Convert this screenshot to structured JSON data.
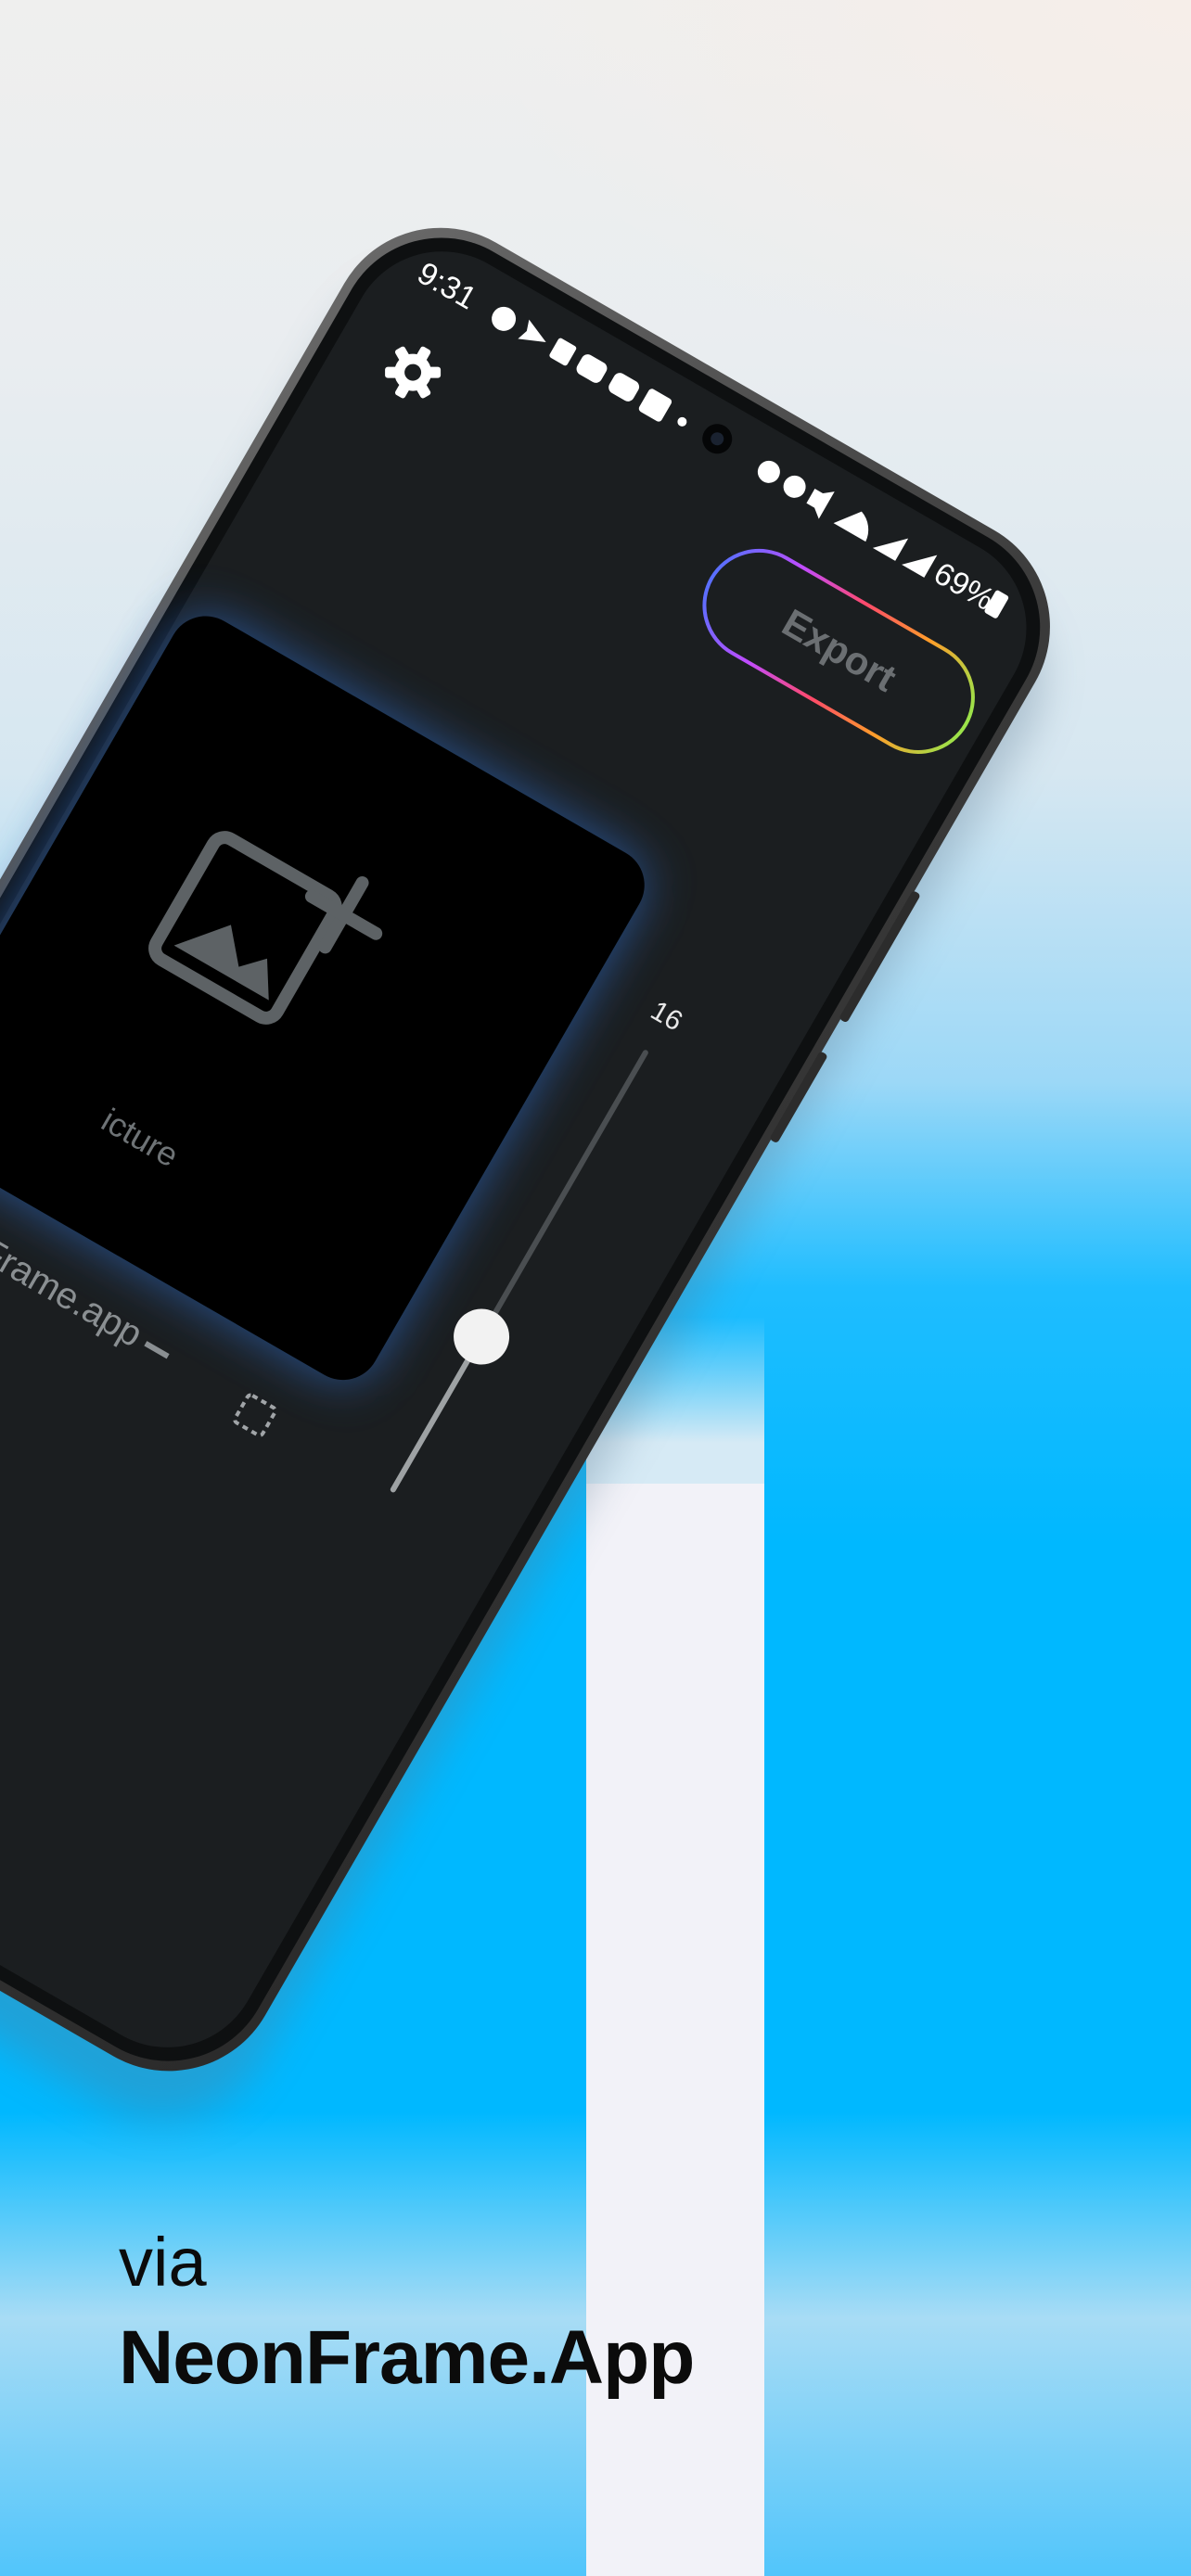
{
  "status_bar": {
    "time": "9:31",
    "battery": "69%",
    "left_icons": [
      "chat-bubble-icon",
      "send-icon",
      "news-icon",
      "youtube-icon",
      "youtube-icon",
      "linkedin-icon",
      "dot-icon"
    ],
    "right_icons": [
      "alarm-icon",
      "alarm-icon",
      "mute-icon",
      "wifi-icon",
      "signal-icon",
      "signal-icon",
      "battery-icon"
    ]
  },
  "app": {
    "export_label": "Export",
    "add_picture_label": "icture",
    "handle_label": "Frame.app",
    "slider_value": "16",
    "slider_level": 0.35
  },
  "tagline": {
    "via": "via",
    "brand": "NeonFrame.App"
  },
  "colors": {
    "screen": "#1b1e20",
    "card": "#000000",
    "glow": "#2e6fd0",
    "accent_blue": "#00b8ff",
    "stripe": "#f2f2f8"
  }
}
